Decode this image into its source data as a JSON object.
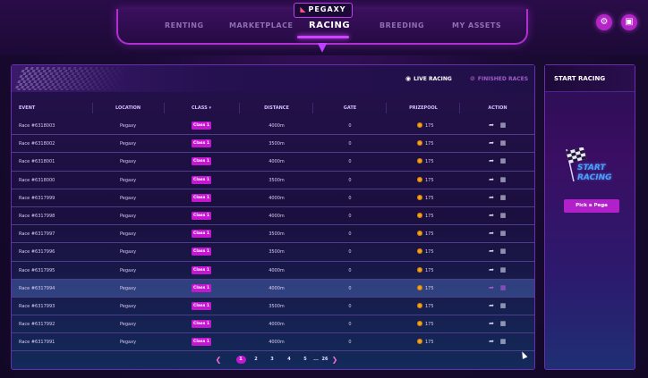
{
  "brand": {
    "logo_text": "PEGAXY"
  },
  "nav": {
    "items": [
      {
        "label": "RENTING",
        "active": false
      },
      {
        "label": "MARKETPLACE",
        "active": false
      },
      {
        "label": "RACING",
        "active": true
      },
      {
        "label": "BREEDING",
        "active": false
      },
      {
        "label": "MY ASSETS",
        "active": false
      }
    ]
  },
  "header_buttons": {
    "settings_icon": "gear-icon",
    "wallet_icon": "wallet-icon"
  },
  "tabs": {
    "live": {
      "label": "LIVE RACING",
      "active": true
    },
    "finished": {
      "label": "FINISHED RACES",
      "active": false
    }
  },
  "table": {
    "columns": [
      "EVENT",
      "LOCATION",
      "CLASS",
      "DISTANCE",
      "GATE",
      "PRIZEPOOL",
      "ACTION"
    ],
    "sort_indicator": "▾",
    "rows": [
      {
        "event": "Race #6318003",
        "location": "Pegaxy",
        "class": "Class 1",
        "distance": "4000m",
        "gate": "0",
        "prizepool": "175"
      },
      {
        "event": "Race #6318002",
        "location": "Pegaxy",
        "class": "Class 1",
        "distance": "3500m",
        "gate": "0",
        "prizepool": "175"
      },
      {
        "event": "Race #6318001",
        "location": "Pegaxy",
        "class": "Class 1",
        "distance": "4000m",
        "gate": "0",
        "prizepool": "175"
      },
      {
        "event": "Race #6318000",
        "location": "Pegaxy",
        "class": "Class 1",
        "distance": "3500m",
        "gate": "0",
        "prizepool": "175"
      },
      {
        "event": "Race #6317999",
        "location": "Pegaxy",
        "class": "Class 1",
        "distance": "4000m",
        "gate": "0",
        "prizepool": "175"
      },
      {
        "event": "Race #6317998",
        "location": "Pegaxy",
        "class": "Class 1",
        "distance": "4000m",
        "gate": "0",
        "prizepool": "175"
      },
      {
        "event": "Race #6317997",
        "location": "Pegaxy",
        "class": "Class 1",
        "distance": "3500m",
        "gate": "0",
        "prizepool": "175"
      },
      {
        "event": "Race #6317996",
        "location": "Pegaxy",
        "class": "Class 1",
        "distance": "3500m",
        "gate": "0",
        "prizepool": "175"
      },
      {
        "event": "Race #6317995",
        "location": "Pegaxy",
        "class": "Class 1",
        "distance": "4000m",
        "gate": "0",
        "prizepool": "175"
      },
      {
        "event": "Race #6317994",
        "location": "Pegaxy",
        "class": "Class 1",
        "distance": "4000m",
        "gate": "0",
        "prizepool": "175",
        "highlighted": true
      },
      {
        "event": "Race #6317993",
        "location": "Pegaxy",
        "class": "Class 1",
        "distance": "3500m",
        "gate": "0",
        "prizepool": "175"
      },
      {
        "event": "Race #6317992",
        "location": "Pegaxy",
        "class": "Class 1",
        "distance": "4000m",
        "gate": "0",
        "prizepool": "175"
      },
      {
        "event": "Race #6317991",
        "location": "Pegaxy",
        "class": "Class 1",
        "distance": "4000m",
        "gate": "0",
        "prizepool": "175"
      }
    ]
  },
  "pagination": {
    "prev_icon": "chevron-left-icon",
    "next_icon": "chevron-right-icon",
    "pages": [
      "1",
      "2",
      "3",
      "4",
      "5",
      "...",
      "26"
    ],
    "current": "1"
  },
  "sidebar": {
    "title": "START RACING",
    "banner_line1": "START",
    "banner_line2": "RACING",
    "button_label": "Pick a Pega"
  }
}
